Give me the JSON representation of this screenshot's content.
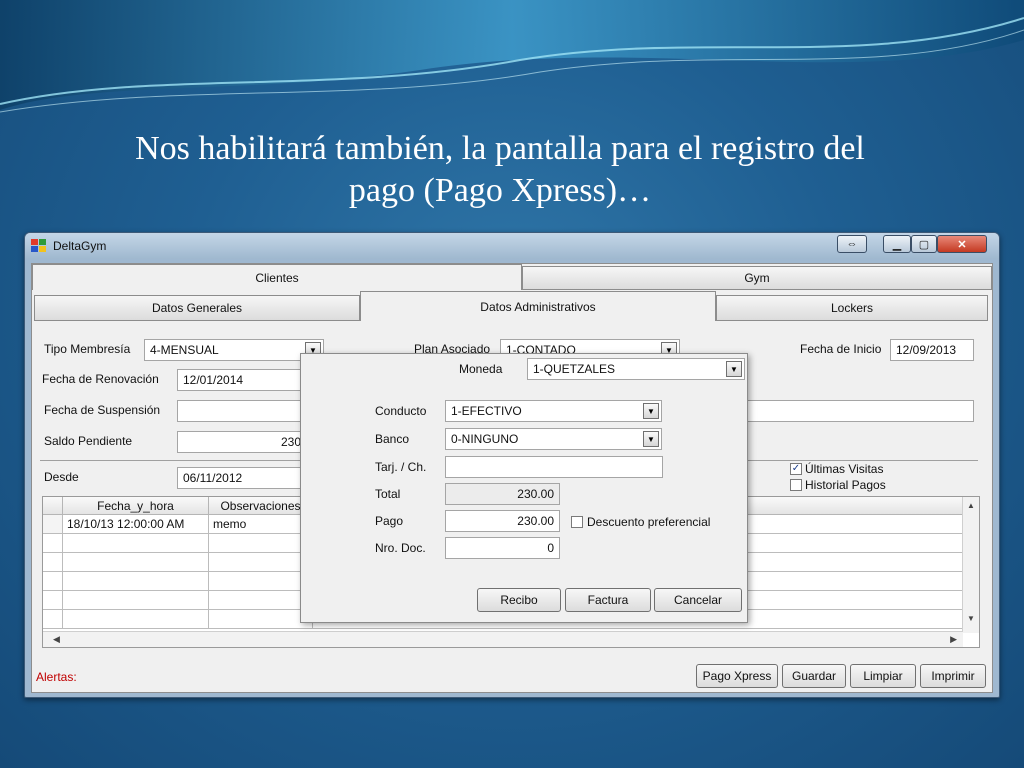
{
  "slide": {
    "title_line1": "Nos habilitará también, la pantalla para el registro del",
    "title_line2": "pago (Pago Xpress)…"
  },
  "window": {
    "title": "DeltaGym",
    "controls": {
      "resize": "⇔",
      "minimize": "▁",
      "maximize": "▢",
      "close": "✕"
    }
  },
  "tabs_top": [
    {
      "label": "Clientes",
      "active": true
    },
    {
      "label": "Gym",
      "active": false
    }
  ],
  "tabs_sub": [
    {
      "label": "Datos Generales",
      "active": false
    },
    {
      "label": "Datos Administrativos",
      "active": true
    },
    {
      "label": "Lockers",
      "active": false
    }
  ],
  "form": {
    "tipo_membresia_label": "Tipo Membresía",
    "tipo_membresia_value": "4-MENSUAL",
    "plan_asociado_label": "Plan Asociado",
    "plan_asociado_value": "1-CONTADO",
    "fecha_inicio_label": "Fecha de Inicio",
    "fecha_inicio_value": "12/09/2013",
    "fecha_renovacion_label": "Fecha de Renovación",
    "fecha_renovacion_value": "12/01/2014",
    "fecha_suspension_label": "Fecha de Suspensión",
    "fecha_suspension_value": "",
    "saldo_pendiente_label": "Saldo Pendiente",
    "saldo_pendiente_value": "230",
    "desde_label": "Desde",
    "desde_value": "06/11/2012",
    "ultimas_visitas_label": "Últimas Visitas",
    "ultimas_visitas_checked": true,
    "historial_pagos_label": "Historial Pagos",
    "historial_pagos_checked": false
  },
  "grid": {
    "columns": [
      "Fecha_y_hora",
      "Observaciones"
    ],
    "rows": [
      [
        "18/10/13 12:00:00 AM",
        "memo"
      ],
      [
        "",
        ""
      ],
      [
        "",
        ""
      ],
      [
        "",
        ""
      ],
      [
        "",
        ""
      ],
      [
        "",
        ""
      ]
    ]
  },
  "footer": {
    "alertas_label": "Alertas:",
    "buttons": [
      "Pago Xpress",
      "Guardar",
      "Limpiar",
      "Imprimir"
    ]
  },
  "dialog": {
    "moneda_label": "Moneda",
    "moneda_value": "1-QUETZALES",
    "conducto_label": "Conducto",
    "conducto_value": "1-EFECTIVO",
    "banco_label": "Banco",
    "banco_value": "0-NINGUNO",
    "tarj_label": "Tarj. / Ch.",
    "tarj_value": "",
    "total_label": "Total",
    "total_value": "230.00",
    "pago_label": "Pago",
    "pago_value": "230.00",
    "descuento_label": "Descuento preferencial",
    "descuento_checked": false,
    "nro_doc_label": "Nro. Doc.",
    "nro_doc_value": "0",
    "buttons": [
      "Recibo",
      "Factura",
      "Cancelar"
    ]
  },
  "colors": {
    "alert_text": "#c00000",
    "slide_bg": "#1f5f92"
  }
}
